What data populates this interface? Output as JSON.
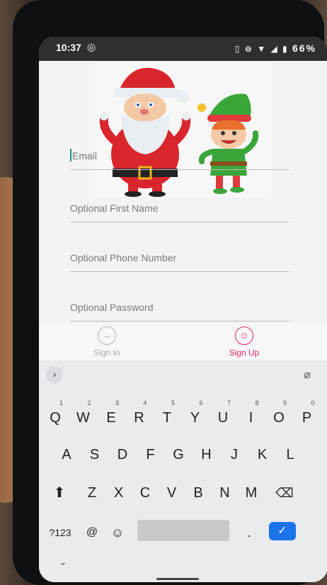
{
  "status_bar": {
    "time": "10:37",
    "battery": "66%"
  },
  "form": {
    "email_placeholder": "Email",
    "first_name_placeholder": "Optional First Name",
    "phone_placeholder": "Optional Phone Number",
    "password_placeholder": "Optional Password"
  },
  "tabs": {
    "sign_in": "Sign In",
    "sign_up": "Sign Up"
  },
  "keyboard": {
    "row1": [
      {
        "k": "Q",
        "h": "1"
      },
      {
        "k": "W",
        "h": "2"
      },
      {
        "k": "E",
        "h": "3"
      },
      {
        "k": "R",
        "h": "4"
      },
      {
        "k": "T",
        "h": "5"
      },
      {
        "k": "Y",
        "h": "6"
      },
      {
        "k": "U",
        "h": "7"
      },
      {
        "k": "I",
        "h": "8"
      },
      {
        "k": "O",
        "h": "9"
      },
      {
        "k": "P",
        "h": "0"
      }
    ],
    "row2": [
      "A",
      "S",
      "D",
      "F",
      "G",
      "H",
      "J",
      "K",
      "L"
    ],
    "row3": [
      "Z",
      "X",
      "C",
      "V",
      "B",
      "N",
      "M"
    ],
    "symbols_label": "?123",
    "at_label": "@",
    "period_label": "."
  },
  "colors": {
    "accent": "#e0245e",
    "inactive": "#a8a8a8",
    "enter": "#1a73e8",
    "cursor": "#1a8f8c"
  }
}
